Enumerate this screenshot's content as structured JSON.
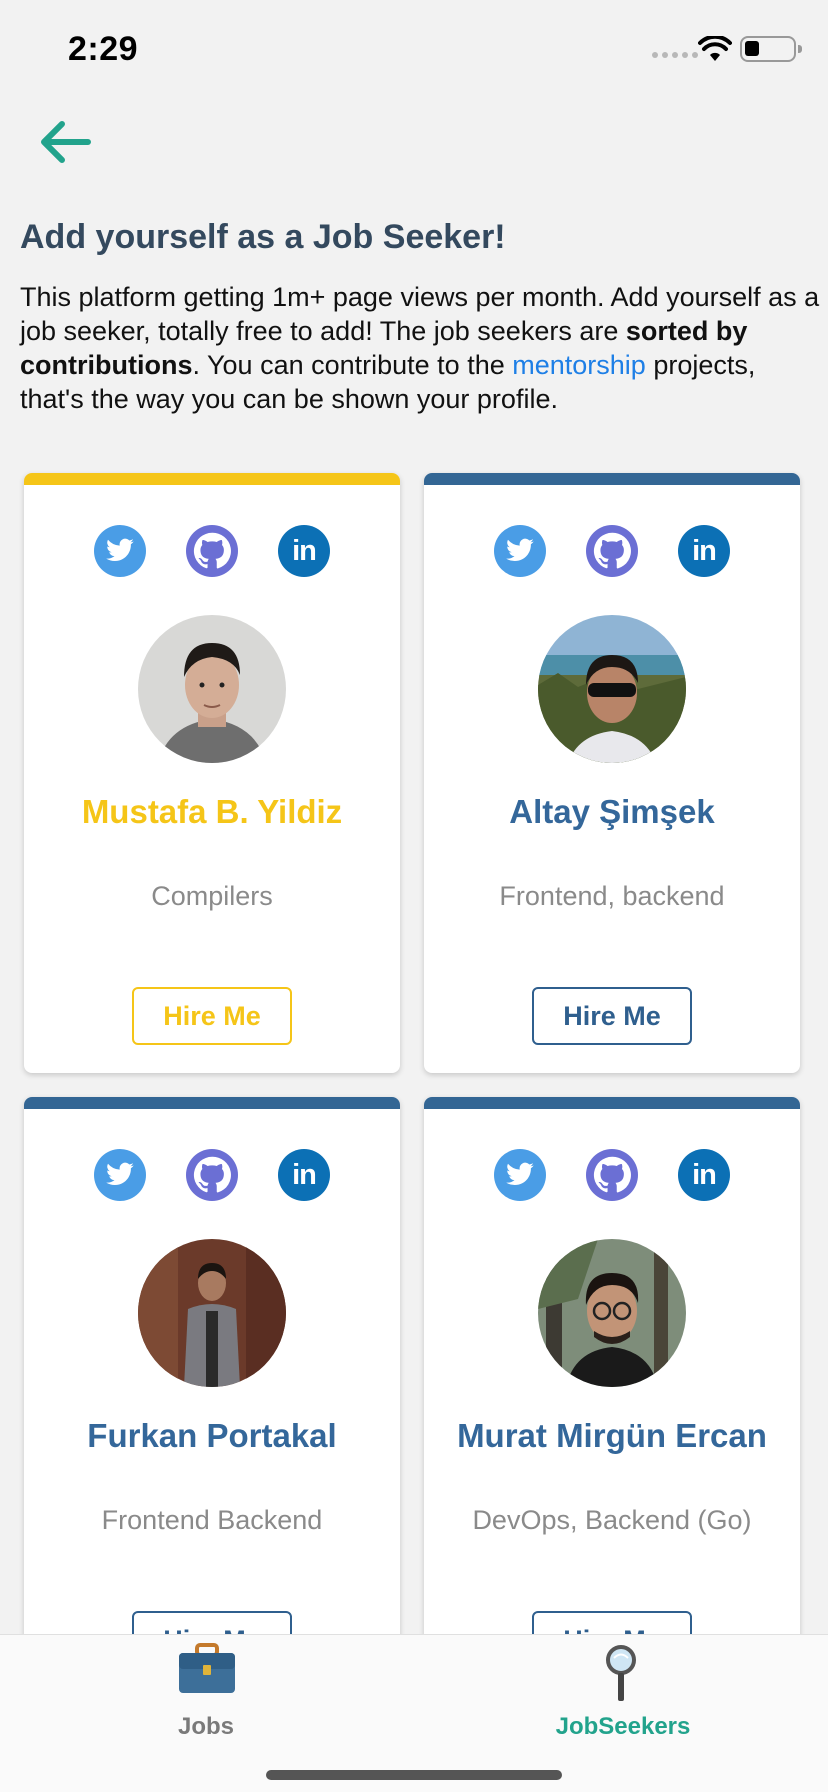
{
  "status_bar": {
    "time": "2:29"
  },
  "header": {
    "title": "Add yourself as a Job Seeker!",
    "intro_part1": "This platform getting 1m+ page views per month. Add yourself as a job seeker, totally free to add! The job seekers are ",
    "intro_bold": "sorted by contributions",
    "intro_part2": ". You can contribute to the ",
    "intro_link": "mentorship",
    "intro_part3": " projects, that's the way you can be shown your profile."
  },
  "seekers": [
    {
      "name": "Mustafa B. Yildiz",
      "skills": "Compilers",
      "button": "Hire Me",
      "accent_color": "#f5c518"
    },
    {
      "name": "Altay Şimşek",
      "skills": "Frontend, backend",
      "button": "Hire Me",
      "accent_color": "#336694"
    },
    {
      "name": "Furkan Portakal",
      "skills": "Frontend Backend",
      "button": "Hire Me",
      "accent_color": "#336694"
    },
    {
      "name": "Murat Mirgün Ercan",
      "skills": "DevOps, Backend (Go)",
      "button": "Hire Me",
      "accent_color": "#336694"
    }
  ],
  "tabs": [
    {
      "label": "Jobs",
      "icon": "briefcase-icon",
      "active": false
    },
    {
      "label": "JobSeekers",
      "icon": "magnifier-icon",
      "active": true
    }
  ],
  "colors": {
    "active_tab": "#22a38c",
    "back_arrow": "#22a38c",
    "link": "#1e7fe6"
  }
}
